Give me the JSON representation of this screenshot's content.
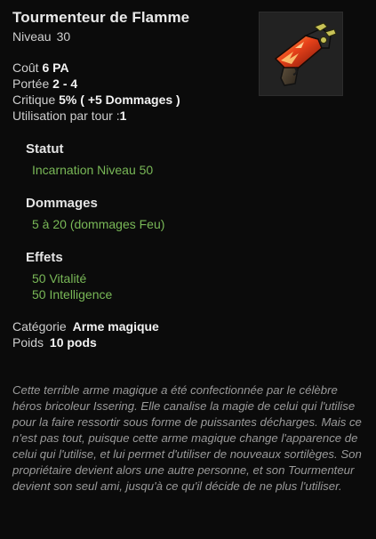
{
  "item": {
    "name": "Tourmenteur de Flamme",
    "level_label": "Niveau",
    "level_value": "30",
    "icon": "flame-pistol-icon"
  },
  "stats": {
    "cost_label": "Coût",
    "cost_value": "6 PA",
    "range_label": "Portée",
    "range_value": "2 - 4",
    "crit_label": "Critique",
    "crit_value": "5% ( +5 Dommages )",
    "uses_label": "Utilisation par tour :",
    "uses_value": "1"
  },
  "sections": {
    "status_title": "Statut",
    "status_lines": [
      "Incarnation Niveau 50"
    ],
    "damage_title": "Dommages",
    "damage_lines": [
      "5 à 20 (dommages Feu)"
    ],
    "effects_title": "Effets",
    "effects_lines": [
      "50 Vitalité",
      "50 Intelligence"
    ]
  },
  "meta": {
    "category_label": "Catégorie",
    "category_value": "Arme magique",
    "weight_label": "Poids",
    "weight_value": "10 pods"
  },
  "description": "Cette terrible arme magique a été confectionnée par le célèbre héros bricoleur Issering. Elle canalise la magie de celui qui l'utilise pour la faire ressortir sous forme de puissantes décharges. Mais ce n'est pas tout, puisque cette arme magique change l'apparence de celui qui l'utilise, et lui permet d'utiliser de nouveaux sortilèges. Son propriétaire devient alors une autre personne, et son Tourmenteur devient son seul ami, jusqu'à ce qu'il décide de ne plus l'utiliser.",
  "colors": {
    "background": "#0b0b0b",
    "effect_green": "#79b857",
    "heading": "#e4e4e4",
    "description": "#9a9a9a"
  }
}
